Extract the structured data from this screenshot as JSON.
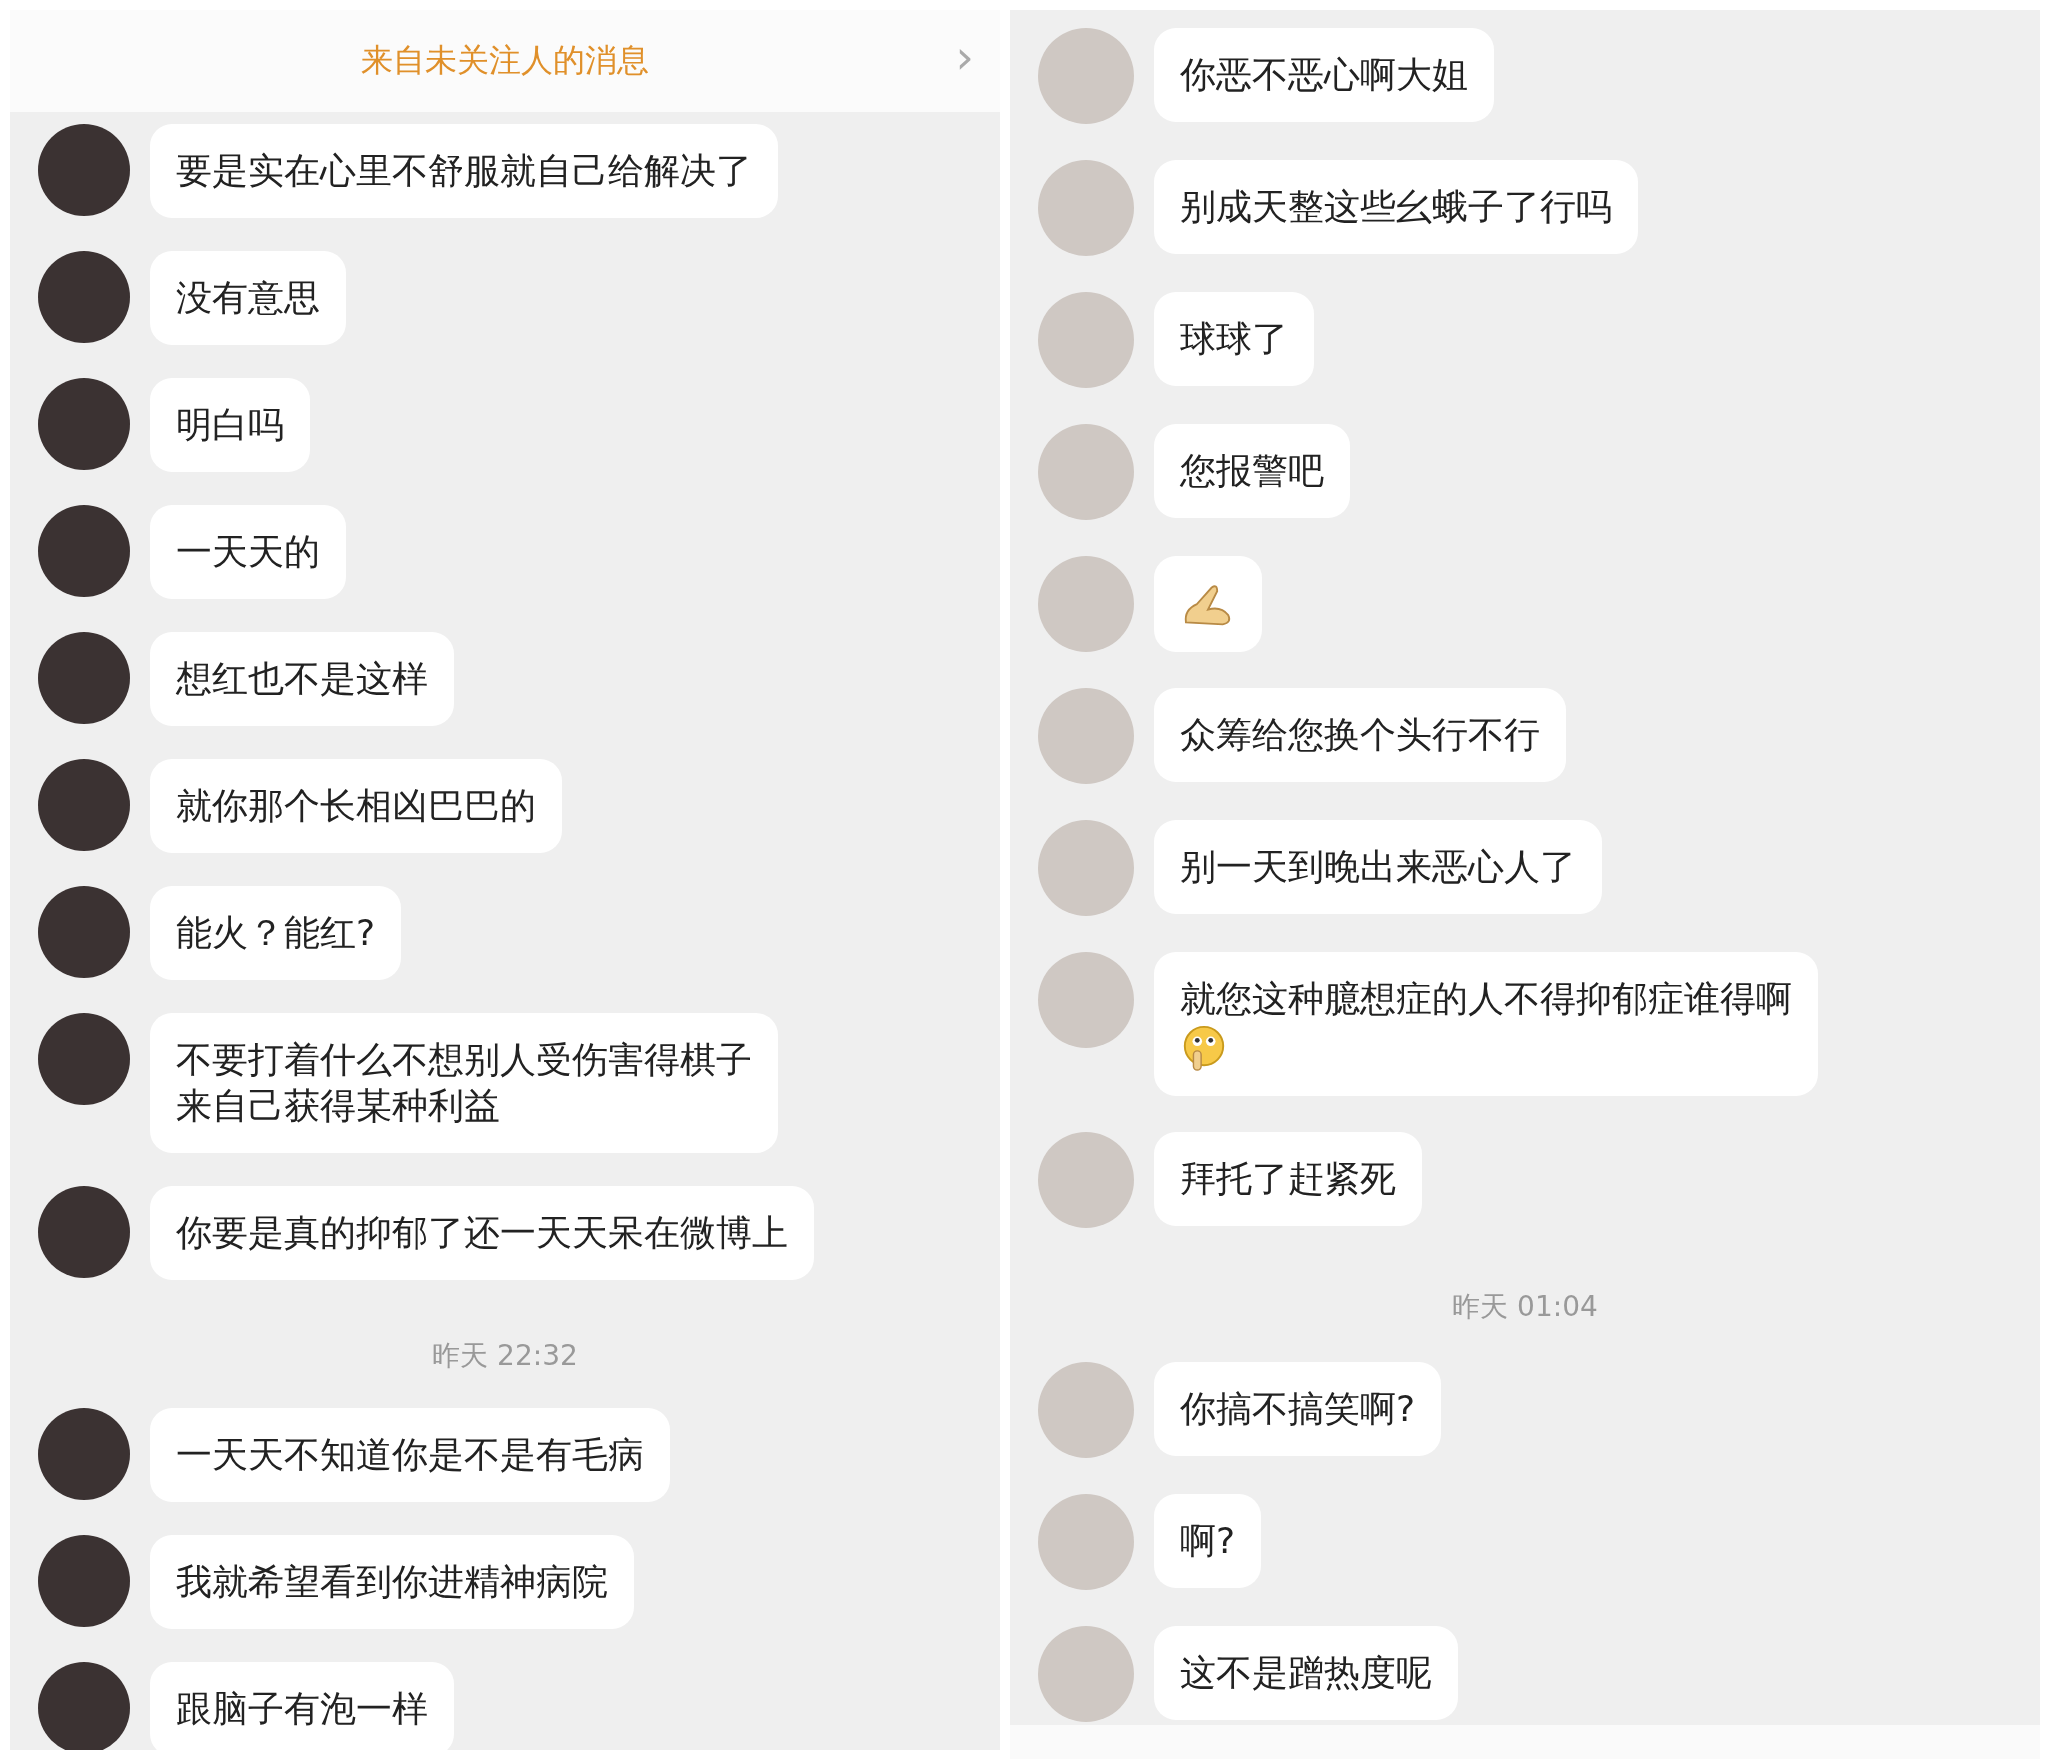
{
  "panels": [
    {
      "header": {
        "title": "来自未关注人的消息",
        "chevron": "›"
      },
      "items": [
        {
          "kind": "message",
          "parts": [
            {
              "kind": "text",
              "text": "要是实在心里不舒服就自己给解决了"
            }
          ]
        },
        {
          "kind": "message",
          "parts": [
            {
              "kind": "text",
              "text": "没有意思"
            }
          ]
        },
        {
          "kind": "message",
          "parts": [
            {
              "kind": "text",
              "text": "明白吗"
            }
          ]
        },
        {
          "kind": "message",
          "parts": [
            {
              "kind": "text",
              "text": "一天天的"
            }
          ]
        },
        {
          "kind": "message",
          "parts": [
            {
              "kind": "text",
              "text": "想红也不是这样"
            }
          ]
        },
        {
          "kind": "message",
          "parts": [
            {
              "kind": "text",
              "text": "就你那个长相凶巴巴的"
            }
          ]
        },
        {
          "kind": "message",
          "parts": [
            {
              "kind": "text",
              "text": "能火？能红?"
            }
          ]
        },
        {
          "kind": "message",
          "parts": [
            {
              "kind": "text",
              "text": "不要打着什么不想别人受伤害得棋子"
            },
            {
              "kind": "text",
              "text": "来自己获得某种利益"
            }
          ]
        },
        {
          "kind": "message",
          "parts": [
            {
              "kind": "text",
              "text": "你要是真的抑郁了还一天天呆在微博上"
            }
          ]
        },
        {
          "kind": "timestamp",
          "text": "昨天 22:32"
        },
        {
          "kind": "message",
          "parts": [
            {
              "kind": "text",
              "text": "一天天不知道你是不是有毛病"
            }
          ]
        },
        {
          "kind": "message",
          "parts": [
            {
              "kind": "text",
              "text": "我就希望看到你进精神病院"
            }
          ]
        },
        {
          "kind": "message",
          "parts": [
            {
              "kind": "text",
              "text": "跟脑子有泡一样"
            }
          ]
        }
      ]
    },
    {
      "items": [
        {
          "kind": "message",
          "parts": [
            {
              "kind": "text",
              "text": "你恶不恶心啊大姐"
            }
          ]
        },
        {
          "kind": "message",
          "parts": [
            {
              "kind": "text",
              "text": "别成天整这些幺蛾子了行吗"
            }
          ]
        },
        {
          "kind": "message",
          "parts": [
            {
              "kind": "text",
              "text": "球球了"
            }
          ]
        },
        {
          "kind": "message",
          "parts": [
            {
              "kind": "text",
              "text": "您报警吧"
            }
          ]
        },
        {
          "kind": "message",
          "parts": [
            {
              "kind": "hands_emoji"
            }
          ]
        },
        {
          "kind": "message",
          "parts": [
            {
              "kind": "text",
              "text": "众筹给您换个头行不行"
            }
          ]
        },
        {
          "kind": "message",
          "parts": [
            {
              "kind": "text",
              "text": "别一天到晚出来恶心人了"
            }
          ]
        },
        {
          "kind": "message",
          "parts": [
            {
              "kind": "text",
              "text": "就您这种臆想症的人不得抑郁症谁得啊"
            },
            {
              "kind": "shush_emoji"
            }
          ]
        },
        {
          "kind": "message",
          "parts": [
            {
              "kind": "text",
              "text": "拜托了赶紧死"
            }
          ]
        },
        {
          "kind": "timestamp",
          "text": "昨天 01:04"
        },
        {
          "kind": "message",
          "parts": [
            {
              "kind": "text",
              "text": "你搞不搞笑啊?"
            }
          ]
        },
        {
          "kind": "message",
          "parts": [
            {
              "kind": "text",
              "text": "啊?"
            }
          ]
        },
        {
          "kind": "message",
          "parts": [
            {
              "kind": "text",
              "text": "这不是蹭热度呢"
            }
          ]
        }
      ]
    }
  ]
}
